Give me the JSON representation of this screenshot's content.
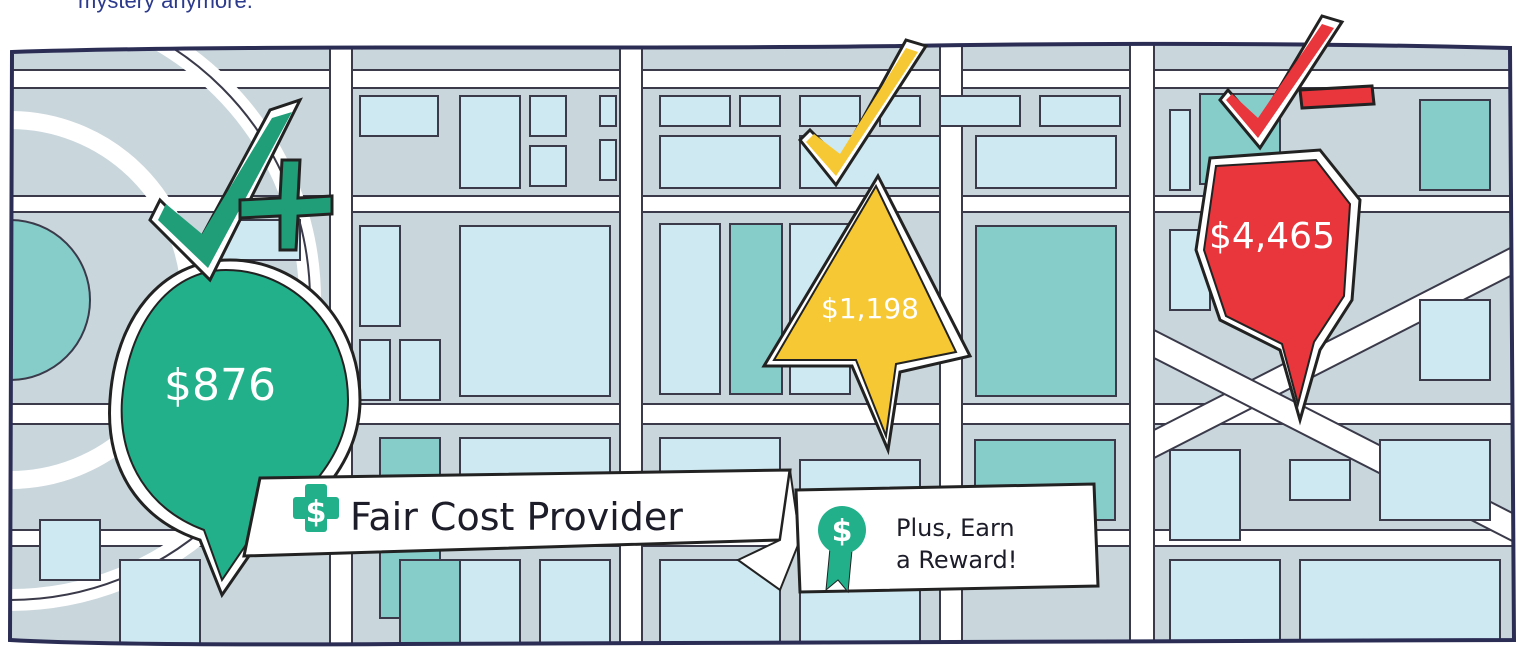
{
  "caption": {
    "text": "mystery anymore."
  },
  "pins": [
    {
      "id": "green",
      "price": "$876",
      "color": "#22b08a",
      "mark": "check-plus"
    },
    {
      "id": "yellow",
      "price": "$1,198",
      "color": "#f6c833",
      "mark": "check"
    },
    {
      "id": "red",
      "price": "$4,465",
      "color": "#e8363c",
      "mark": "check-minus"
    }
  ],
  "marks": {
    "green": "#1f9e78",
    "yellow": "#f6c833",
    "red": "#e8363c"
  },
  "ribbon": {
    "main_label": "Fair Cost Provider",
    "reward_line1": "Plus, Earn",
    "reward_line2": "a Reward!",
    "badge_symbol": "$"
  },
  "map_colors": {
    "background": "#c9d6dc",
    "block": "#cfe9f2",
    "block_dark": "#86cdca",
    "road": "#ffffff",
    "outline": "#3a3a4a"
  }
}
